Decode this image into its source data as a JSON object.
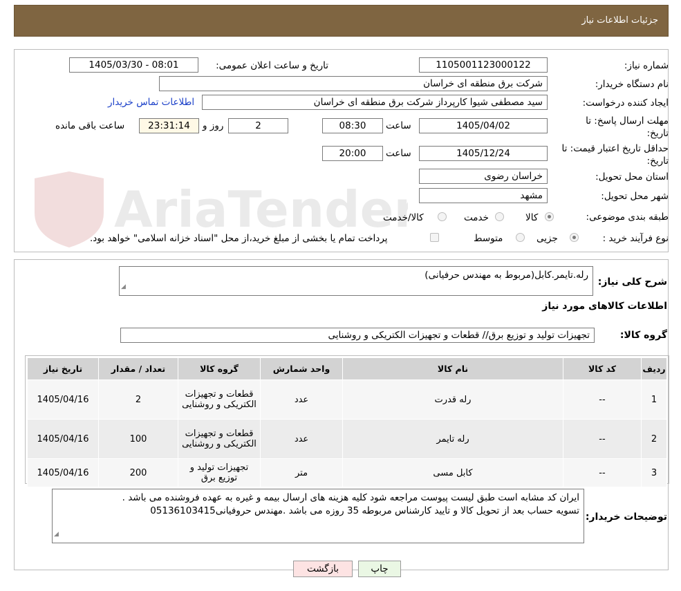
{
  "header": {
    "title": "جزئیات اطلاعات نیاز"
  },
  "watermark": {
    "text": "AriaTender.neT"
  },
  "form": {
    "need_number": {
      "label": "شماره نیاز:",
      "value": "1105001123000122"
    },
    "announce": {
      "label": "تاریخ و ساعت اعلان عمومی:",
      "value": "1405/03/30 - 08:01"
    },
    "buyer": {
      "label": "نام دستگاه خریدار:",
      "value": "شرکت برق منطقه ای خراسان"
    },
    "creator": {
      "label": "ایجاد کننده درخواست:",
      "value": "سید مصطفی شیوا کارپرداز شرکت برق منطقه ای خراسان",
      "contact_link": "اطلاعات تماس خریدار"
    },
    "deadline": {
      "label": "مهلت ارسال پاسخ: تا تاریخ:",
      "date": "1405/04/02",
      "time_label": "ساعت",
      "time": "08:30",
      "days": "2",
      "days_label": "روز و",
      "remaining": "23:31:14",
      "remaining_label": "ساعت باقی مانده"
    },
    "validity": {
      "label": "حداقل تاریخ اعتبار قیمت: تا تاریخ:",
      "date": "1405/12/24",
      "time_label": "ساعت",
      "time": "20:00"
    },
    "province": {
      "label": "استان محل تحویل:",
      "value": "خراسان رضوی"
    },
    "city": {
      "label": "شهر محل تحویل:",
      "value": "مشهد"
    },
    "category": {
      "label": "طبقه بندی موضوعی:",
      "options": [
        "کالا",
        "خدمت",
        "کالا/خدمت"
      ],
      "selected": "کالا"
    },
    "process": {
      "label": "نوع فرآیند خرید :",
      "options": [
        "جزیی",
        "متوسط"
      ],
      "selected": "جزیی",
      "note": "پرداخت تمام یا بخشی از مبلغ خرید،از محل \"اسناد خزانه اسلامی\" خواهد بود."
    }
  },
  "details": {
    "summary_label": "شرح کلی نیاز:",
    "summary": "رله.تایمر.کابل(مربوط به مهندس حرفیانی)",
    "goods_title": "اطلاعات کالاهای مورد نیاز",
    "group_label": "گروه کالا:",
    "group_value": "تجهیزات تولید و توزیع برق// قطعات و تجهیزات الکتریکی و روشنایی"
  },
  "table": {
    "headers": [
      "ردیف",
      "کد کالا",
      "نام کالا",
      "واحد شمارش",
      "گروه کالا",
      "تعداد / مقدار",
      "تاریخ نیاز"
    ],
    "rows": [
      [
        "1",
        "--",
        "رله قدرت",
        "عدد",
        "قطعات و تجهیزات الکتریکی و روشنایی",
        "2",
        "1405/04/16"
      ],
      [
        "2",
        "--",
        "رله تایمر",
        "عدد",
        "قطعات و تجهیزات الکتریکی و روشنایی",
        "100",
        "1405/04/16"
      ],
      [
        "3",
        "--",
        "کابل مسی",
        "متر",
        "تجهیزات تولید و توزیع برق",
        "200",
        "1405/04/16"
      ]
    ]
  },
  "notes": {
    "label": "توضیحات خریدار:",
    "line1": "ایران کد مشابه است طبق لیست پیوست مراجعه شود کلیه هزینه های ارسال بیمه و غیره به عهده فروشنده می باشد .",
    "line2": "تسویه حساب بعد از تحویل کالا و تایید کارشناس مربوطه 35 روزه می باشد .مهندس حروفیانی05136103415"
  },
  "buttons": {
    "print": "چاپ",
    "back": "بازگشت"
  }
}
